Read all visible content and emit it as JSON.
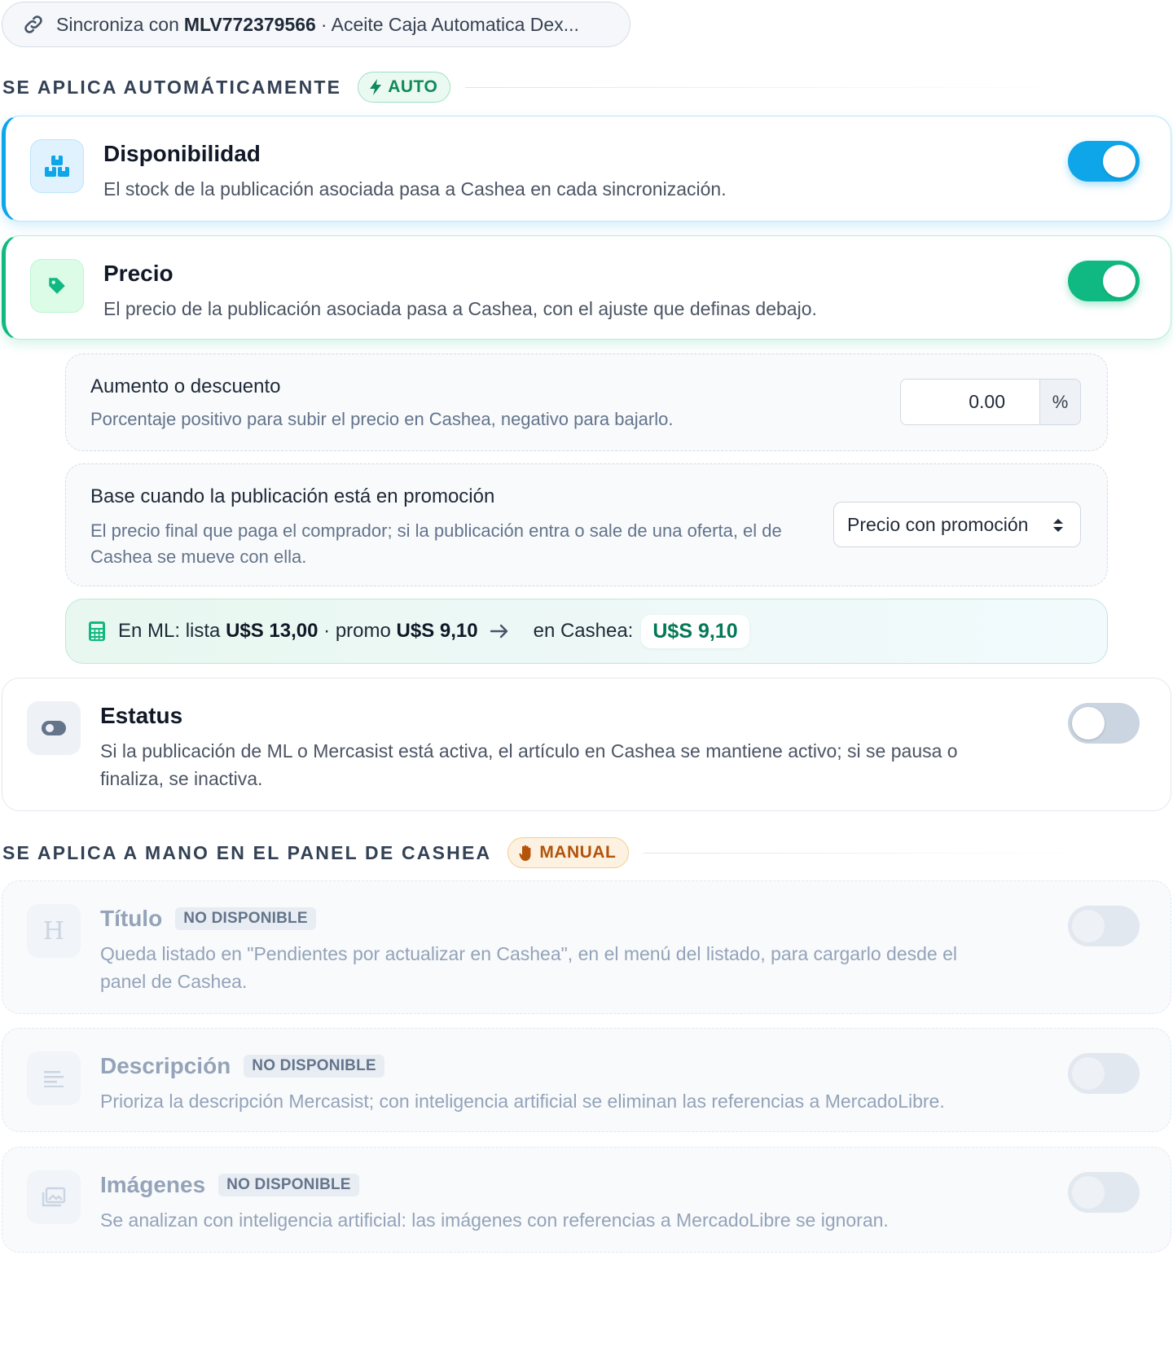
{
  "sync": {
    "prefix": "Sincroniza con",
    "item_id": "MLV772379566",
    "item_title": "· Aceite Caja Automatica Dex..."
  },
  "auto_section": {
    "title": "SE APLICA AUTOMÁTICAMENTE",
    "tag": "AUTO"
  },
  "stock": {
    "title": "Disponibilidad",
    "description": "El stock de la publicación asociada pasa a Cashea en cada sincronización.",
    "enabled": true
  },
  "price": {
    "title": "Precio",
    "description": "El precio de la publicación asociada pasa a Cashea, con el ajuste que definas debajo.",
    "enabled": true
  },
  "adjustment": {
    "title": "Aumento o descuento",
    "description": "Porcentaje positivo para subir el precio en Cashea, negativo para bajarlo.",
    "value": "0.00",
    "unit": "%"
  },
  "promo_base": {
    "title": "Base cuando la publicación está en promoción",
    "description": "El precio final que paga el comprador; si la publicación entra o sale de una oferta, el de Cashea se mueve con ella.",
    "selected": "Precio con promoción"
  },
  "calc": {
    "prefix": "En ML: lista",
    "list_price": "U$S 13,00",
    "promo_label": "· promo",
    "promo_price": "U$S 9,10",
    "cashea_label": "en Cashea:",
    "cashea_price": "U$S 9,10"
  },
  "status": {
    "title": "Estatus",
    "description": "Si la publicación de ML o Mercasist está activa, el artículo en Cashea se mantiene activo; si se pausa o finaliza, se inactiva.",
    "enabled": false
  },
  "manual_section": {
    "title": "SE APLICA A MANO EN EL PANEL DE CASHEA",
    "tag": "MANUAL"
  },
  "title_field": {
    "icon_letter": "H",
    "title": "Título",
    "badge": "NO DISPONIBLE",
    "description": "Queda listado en \"Pendientes por actualizar en Cashea\", en el menú del listado, para cargarlo desde el panel de Cashea."
  },
  "description_field": {
    "title": "Descripción",
    "badge": "NO DISPONIBLE",
    "description": "Prioriza la descripción Mercasist; con inteligencia artificial se eliminan las referencias a MercadoLibre."
  },
  "images_field": {
    "title": "Imágenes",
    "badge": "NO DISPONIBLE",
    "description": "Se analizan con inteligencia artificial: las imágenes con referencias a MercadoLibre se ignoran."
  },
  "colors": {
    "stock_accent": "#0ea5e9",
    "price_accent": "#10b981",
    "auto_tag": "#0f8a5a",
    "manual_tag": "#b45309"
  }
}
